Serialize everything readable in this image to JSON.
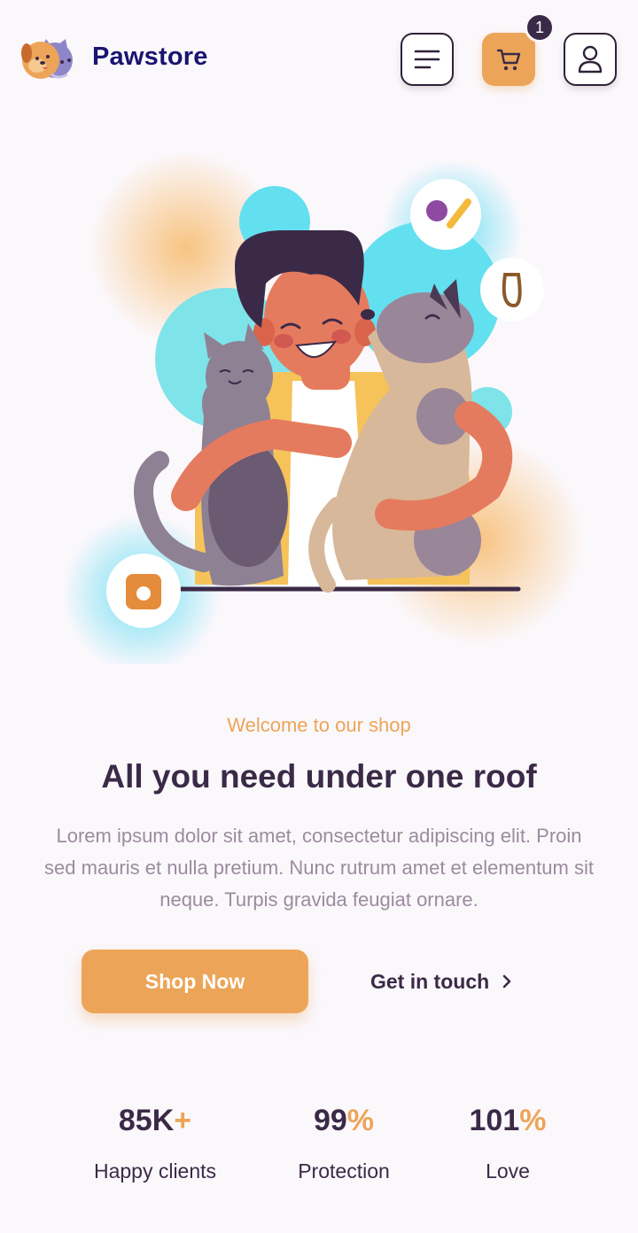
{
  "header": {
    "brand": "Pawstore",
    "cart_count": "1"
  },
  "icons": {
    "menu": "menu-lines-icon",
    "cart": "shopping-cart-icon",
    "user": "user-icon"
  },
  "colors": {
    "accent": "#eca558",
    "brand": "#1a1472",
    "text_dark": "#3b2a47",
    "text_muted": "#9b8b9e",
    "background": "#fbf8fc"
  },
  "hero": {
    "eyebrow": "Welcome to our shop",
    "headline": "All you need under one roof",
    "description": "Lorem ipsum dolor sit amet, consectetur adipiscing elit. Proin sed mauris et nulla pretium. Nunc rutrum amet et elementum sit neque. Turpis gravida feugiat ornare.",
    "primary_button": "Shop Now",
    "secondary_link": "Get in touch"
  },
  "stats": [
    {
      "value": "85K",
      "suffix": "+",
      "label": "Happy clients"
    },
    {
      "value": "99",
      "suffix": "%",
      "label": "Protection"
    },
    {
      "value": "101",
      "suffix": "%",
      "label": "Love"
    }
  ]
}
